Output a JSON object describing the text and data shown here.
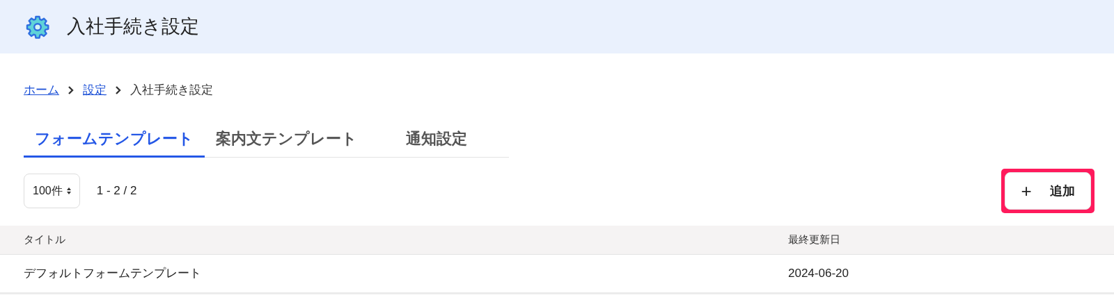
{
  "header": {
    "title": "入社手続き設定"
  },
  "breadcrumb": [
    {
      "label": "ホーム",
      "kind": "link"
    },
    {
      "label": "設定",
      "kind": "link"
    },
    {
      "label": "入社手続き設定",
      "kind": "current"
    }
  ],
  "tabs": [
    {
      "label": "フォームテンプレート",
      "selected": true
    },
    {
      "label": "案内文テンプレート",
      "selected": false
    },
    {
      "label": "通知設定",
      "selected": false
    }
  ],
  "toolbar": {
    "page_size": "100件",
    "range": "1 - 2 / 2",
    "add_button": {
      "icon": "+",
      "label": "追加",
      "highlighted": true
    }
  },
  "table": {
    "columns": [
      "タイトル",
      "最終更新日"
    ],
    "rows": [
      [
        "デフォルトフォームテンプレート",
        "2024-06-20"
      ]
    ]
  }
}
